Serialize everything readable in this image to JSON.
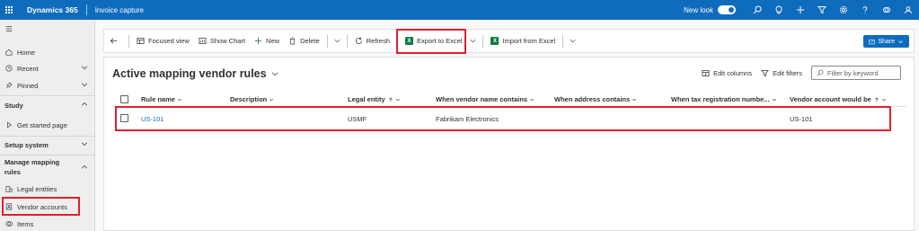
{
  "topbar": {
    "brand": "Dynamics 365",
    "app_name": "Invoice capture",
    "new_look_label": "New look",
    "icons": [
      "search-icon",
      "lightbulb-icon",
      "plus-icon",
      "filter-icon",
      "gear-icon",
      "help-icon",
      "copilot-icon",
      "avatar-icon"
    ]
  },
  "sidebar": {
    "items": [
      {
        "label": "Home",
        "icon": "home-icon"
      },
      {
        "label": "Recent",
        "icon": "clock-icon"
      },
      {
        "label": "Pinned",
        "icon": "pin-icon"
      }
    ],
    "section_study": {
      "title": "Study",
      "items": [
        {
          "label": "Get started page",
          "icon": "play-icon"
        }
      ]
    },
    "section_setup": {
      "title": "Setup system"
    },
    "section_mapping": {
      "title_line1": "Manage mapping",
      "title_line2": "rules",
      "items": [
        {
          "label": "Legal entities",
          "icon": "entity-icon"
        },
        {
          "label": "Vendor accounts",
          "icon": "vendor-icon"
        },
        {
          "label": "Items",
          "icon": "items-icon"
        }
      ]
    }
  },
  "commandbar": {
    "focused_view": "Focused view",
    "show_chart": "Show Chart",
    "new": "New",
    "delete": "Delete",
    "refresh": "Refresh",
    "export_excel": "Export to Excel",
    "import_excel": "Import from Excel",
    "share": "Share"
  },
  "view": {
    "title": "Active mapping vendor rules",
    "edit_columns": "Edit columns",
    "edit_filters": "Edit filters",
    "filter_placeholder": "Filter by keyword"
  },
  "grid": {
    "columns": [
      "Rule name",
      "Description",
      "Legal entity",
      "When vendor name contains",
      "When address contains",
      "When tax registration numbe...",
      "Vendor account would be"
    ],
    "rows": [
      {
        "rule_name": "US-101",
        "description": "",
        "legal_entity": "USMF",
        "vendor_name_contains": "Fabrikam Electronics",
        "address_contains": "",
        "tax_registration": "",
        "vendor_account": "US-101"
      }
    ]
  },
  "colors": {
    "brand_blue": "#0f6cbd",
    "highlight_red": "#e0202e",
    "excel_green": "#107c41"
  }
}
